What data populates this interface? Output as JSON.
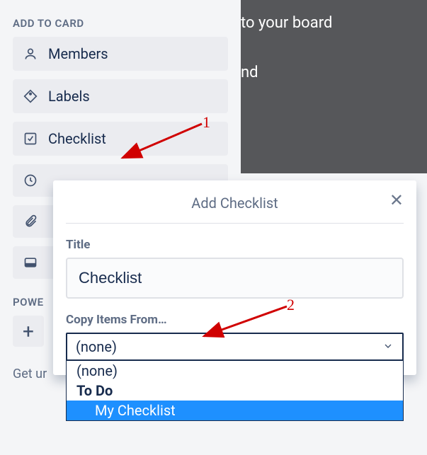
{
  "backdrop": {
    "line1": "to your board",
    "line2": "nd"
  },
  "sidebar": {
    "header": "ADD TO CARD",
    "buttons": {
      "members": "Members",
      "labels": "Labels",
      "checklist": "Checklist"
    },
    "powerups_header": "POWE",
    "getun": "Get ur"
  },
  "popover": {
    "title": "Add Checklist",
    "title_label": "Title",
    "title_value": "Checklist",
    "copy_label": "Copy Items From…",
    "select_value": "(none)",
    "options": {
      "none": "(none)",
      "group": "To Do",
      "sub": "My Checklist"
    }
  },
  "annotations": {
    "one": "1",
    "two": "2"
  }
}
